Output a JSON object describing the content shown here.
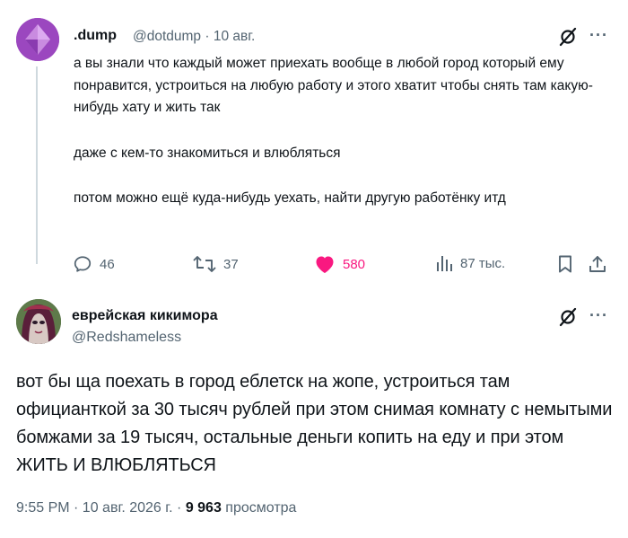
{
  "tweet1": {
    "name": ".dump",
    "handle_time": "@dotdump · 10 авг.",
    "paragraphs": [
      "а вы знали что каждый может приехать вообще в любой город который ему понравится, устроиться на любую работу и этого хватит чтобы снять там какую-нибудь хату и жить так",
      "даже с кем-то знакомиться и влюбляться",
      "потом можно ещё куда-нибудь уехать, найти другую работёнку итд"
    ],
    "more_label": "···",
    "actions": {
      "replies": "46",
      "reposts": "37",
      "likes": "580",
      "views": "87 тыс."
    },
    "colors": {
      "like_active": "#f91880",
      "avatar": "#a24fc4"
    }
  },
  "tweet2": {
    "name": "еврейская кикимора",
    "handle": "@Redshameless",
    "more_label": "···",
    "body": "вот бы ща поехать в город еблетск на жопе, устроиться там официанткой за 30 тысяч рублей при этом снимая комнату с немытыми бомжами за 19 тысяч, остальные деньги копить на еду и при этом ЖИТЬ И ВЛЮБЛЯТЬСЯ",
    "meta_time": "9:55 PM · 10 авг. 2026 г. · ",
    "views_count": "9 963",
    "views_label": " просмотра"
  }
}
